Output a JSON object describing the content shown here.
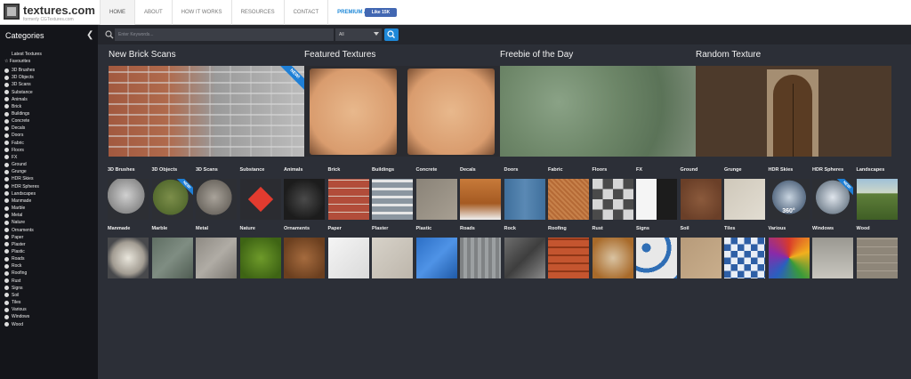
{
  "brand": {
    "name": "textures.com",
    "tagline": "formerly CGTextures.com"
  },
  "nav": {
    "items": [
      "HOME",
      "ABOUT",
      "HOW IT WORKS",
      "RESOURCES",
      "CONTACT",
      "PREMIUM ACCESS"
    ],
    "like_label": "Like 15K"
  },
  "sidebar": {
    "heading": "Categories",
    "latest": "Latest Textures",
    "favourites": "Favourites",
    "items": [
      "3D Brushes",
      "3D Objects",
      "3D Scans",
      "Substance",
      "Animals",
      "Brick",
      "Buildings",
      "Concrete",
      "Decals",
      "Doors",
      "Fabric",
      "Floors",
      "FX",
      "Ground",
      "Grunge",
      "HDR Skies",
      "HDR Spheres",
      "Landscapes",
      "Manmade",
      "Marble",
      "Metal",
      "Nature",
      "Ornaments",
      "Paper",
      "Plaster",
      "Plastic",
      "Roads",
      "Rock",
      "Roofing",
      "Rust",
      "Signs",
      "Soil",
      "Tiles",
      "Various",
      "Windows",
      "Wood"
    ]
  },
  "search": {
    "placeholder": "Enter Keywords...",
    "filter": "All"
  },
  "featured": [
    {
      "title": "New Brick Scans",
      "badge": "NEW!"
    },
    {
      "title": "Featured Textures"
    },
    {
      "title": "Freebie of the Day"
    },
    {
      "title": "Random Texture"
    }
  ],
  "grid": {
    "row1": [
      "3D Brushes",
      "3D Objects",
      "3D Scans",
      "Substance",
      "Animals",
      "Brick",
      "Buildings",
      "Concrete",
      "Decals",
      "Doors",
      "Fabric",
      "Floors",
      "FX",
      "Ground",
      "Grunge",
      "HDR Skies",
      "HDR Spheres",
      "Landscapes"
    ],
    "row2": [
      "Manmade",
      "Marble",
      "Metal",
      "Nature",
      "Ornaments",
      "Paper",
      "Plaster",
      "Plastic",
      "Roads",
      "Rock",
      "Roofing",
      "Rust",
      "Signs",
      "Soil",
      "Tiles",
      "Various",
      "Windows",
      "Wood"
    ],
    "new_badge": "NEW!",
    "hdr_badge": "360°"
  },
  "colors": {
    "accent": "#1e88d8",
    "sidebar_bg": "#14151a",
    "page_bg": "#2c2f37"
  }
}
